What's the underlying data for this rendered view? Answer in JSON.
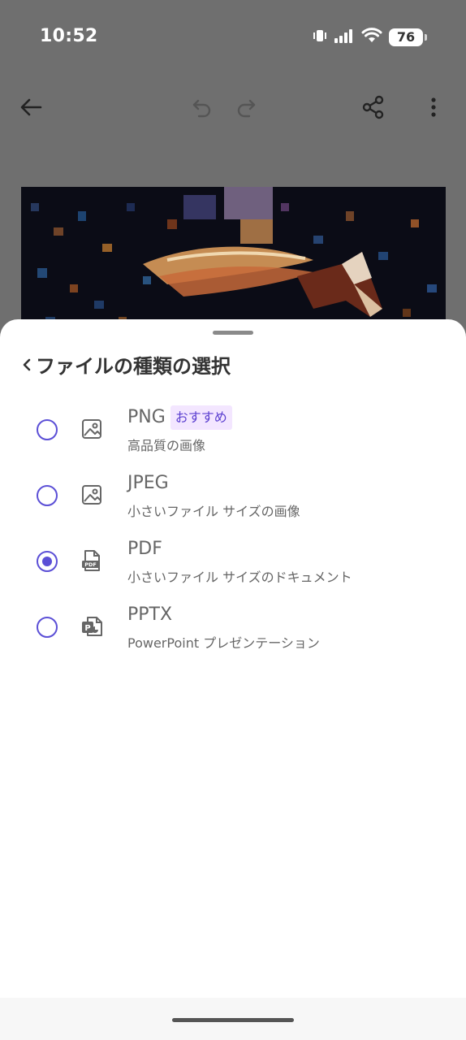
{
  "status_bar": {
    "time": "10:52",
    "battery": "76"
  },
  "toolbar": {
    "icons": [
      "back-arrow-icon",
      "undo-icon",
      "redo-icon",
      "share-icon",
      "more-vertical-icon"
    ]
  },
  "sheet": {
    "title": "ファイルの種類の選択",
    "options": [
      {
        "title": "PNG",
        "badge": "おすすめ",
        "subtitle": "高品質の画像",
        "selected": false,
        "icon": "image-icon"
      },
      {
        "title": "JPEG",
        "subtitle": "小さいファイル サイズの画像",
        "selected": false,
        "icon": "image-icon"
      },
      {
        "title": "PDF",
        "subtitle": "小さいファイル サイズのドキュメント",
        "selected": true,
        "icon": "pdf-file-icon"
      },
      {
        "title": "PPTX",
        "subtitle": "PowerPoint プレゼンテーション",
        "selected": false,
        "icon": "powerpoint-file-icon"
      }
    ]
  },
  "colors": {
    "accent": "#5b4fd6",
    "badge_bg": "#f3e6ff",
    "badge_text": "#5b3fd0",
    "scrim": "#6f6f6f"
  }
}
